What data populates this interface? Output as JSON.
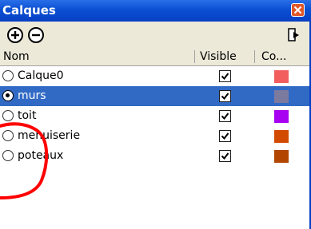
{
  "window": {
    "title": "Calques",
    "close_icon": "close-icon",
    "titlebar_color": "#0a4fd2",
    "close_color": "#e2582b"
  },
  "toolbar": {
    "add_icon": "plus-circle-icon",
    "remove_icon": "minus-circle-icon",
    "details_icon": "details-arrow-icon"
  },
  "table": {
    "headers": {
      "name": "Nom",
      "visible": "Visible",
      "color": "Co..."
    },
    "selection_color": "#316ac5",
    "rows": [
      {
        "name": "Calque0",
        "visible": true,
        "selected": false,
        "color": "#f25e5e"
      },
      {
        "name": "murs",
        "visible": true,
        "selected": true,
        "color": "#7d7aa0"
      },
      {
        "name": "toit",
        "visible": true,
        "selected": false,
        "color": "#a800f0"
      },
      {
        "name": "menuiserie",
        "visible": true,
        "selected": false,
        "color": "#d24a00"
      },
      {
        "name": "poteaux",
        "visible": true,
        "selected": false,
        "color": "#b24600"
      }
    ]
  },
  "annotation": {
    "shape": "red-circle-annotation",
    "color": "#ff0000"
  }
}
